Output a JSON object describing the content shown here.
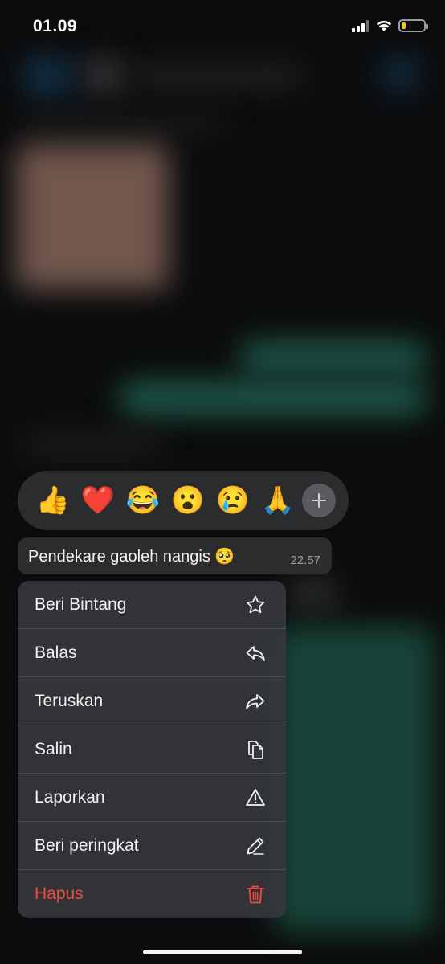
{
  "status_bar": {
    "time": "01.09",
    "battery_level": 0.2
  },
  "reactions": {
    "emojis": [
      {
        "glyph": "👍",
        "name": "thumbs-up"
      },
      {
        "glyph": "❤️",
        "name": "red-heart"
      },
      {
        "glyph": "😂",
        "name": "tears-of-joy"
      },
      {
        "glyph": "😮",
        "name": "open-mouth"
      },
      {
        "glyph": "😢",
        "name": "crying-face"
      },
      {
        "glyph": "🙏",
        "name": "folded-hands"
      }
    ],
    "more_icon": "plus-icon"
  },
  "message": {
    "text": "Pendekare gaoleh nangis 🥺",
    "time": "22.57"
  },
  "menu": {
    "items": [
      {
        "label": "Beri Bintang",
        "icon": "star-icon"
      },
      {
        "label": "Balas",
        "icon": "reply-icon"
      },
      {
        "label": "Teruskan",
        "icon": "forward-icon"
      },
      {
        "label": "Salin",
        "icon": "copy-icon"
      },
      {
        "label": "Laporkan",
        "icon": "warning-icon"
      },
      {
        "label": "Beri peringkat",
        "icon": "pencil-icon"
      },
      {
        "label": "Hapus",
        "icon": "trash-icon"
      }
    ]
  },
  "colors": {
    "danger": "#eb4d3d",
    "accent_green": "#1f5a4a",
    "panel": "#2b2c2e"
  }
}
